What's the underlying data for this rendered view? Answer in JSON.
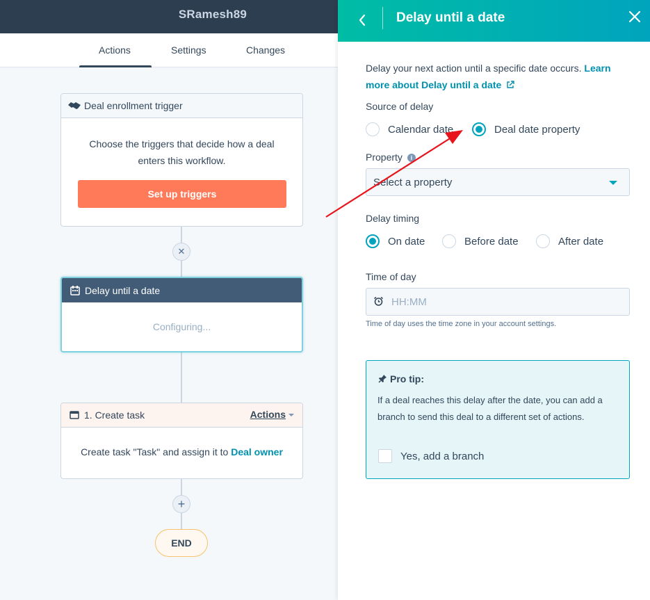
{
  "header": {
    "title": "SRamesh89"
  },
  "tabs": [
    {
      "label": "Actions"
    },
    {
      "label": "Settings"
    },
    {
      "label": "Changes"
    }
  ],
  "workflow": {
    "trigger": {
      "title": "Deal enrollment trigger",
      "body_line1": "Choose the triggers that decide how a deal",
      "body_line2": "enters this workflow.",
      "button": "Set up triggers"
    },
    "remove_symbol": "✕",
    "delay": {
      "title": "Delay until a date",
      "status": "Configuring..."
    },
    "task": {
      "title": "1. Create task",
      "actions_label": "Actions",
      "body_prefix": "Create task \"Task\" and assign it to ",
      "body_link": "Deal owner"
    },
    "add_symbol": "+",
    "end_label": "END"
  },
  "panel": {
    "title": "Delay until a date",
    "description": "Delay your next action until a specific date occurs.",
    "learn_link_1": "Learn",
    "learn_link_2": "more about Delay until a date",
    "source_label": "Source of delay",
    "source_options": [
      {
        "label": "Calendar date",
        "selected": false
      },
      {
        "label": "Deal date property",
        "selected": true
      }
    ],
    "property_label": "Property",
    "property_info": "i",
    "property_placeholder": "Select a property",
    "timing_label": "Delay timing",
    "timing_options": [
      {
        "label": "On date",
        "selected": true
      },
      {
        "label": "Before date",
        "selected": false
      },
      {
        "label": "After date",
        "selected": false
      }
    ],
    "time_label": "Time of day",
    "time_placeholder": "HH:MM",
    "time_hint": "Time of day uses the time zone in your account settings.",
    "pro_tip": {
      "title": "Pro tip:",
      "text": "If a deal reaches this delay after the date, you can add a branch to send this deal to a different set of actions.",
      "checkbox_label": "Yes, add a branch",
      "checked": false
    }
  },
  "colors": {
    "header_bg": "#2d3e50",
    "accent": "#00a4bd",
    "panel_gradient_start": "#00bda5",
    "button_orange": "#ff7a59",
    "annotation_arrow": "#e8141b"
  }
}
